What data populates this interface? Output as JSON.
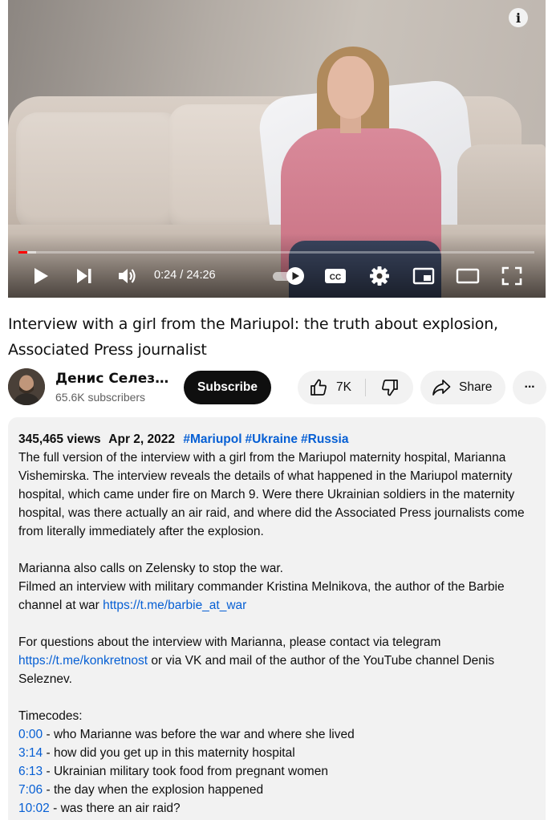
{
  "player": {
    "current_time": "0:24",
    "time_separator": " / ",
    "duration": "24:26",
    "progress_fraction": 0.0164,
    "loaded_fraction": 0.034,
    "info_glyph": "i",
    "icons": [
      "play-icon",
      "next-icon",
      "volume-icon",
      "autoplay-toggle-icon",
      "captions-icon",
      "settings-icon",
      "miniplayer-icon",
      "theater-icon",
      "fullscreen-icon"
    ]
  },
  "video": {
    "title": "Interview with a girl from the Mariupol: the truth about explosion, Associated Press journalist"
  },
  "channel": {
    "name": "Денис Селез…",
    "subscribers": "65.6K subscribers",
    "subscribe_label": "Subscribe"
  },
  "actions": {
    "like_count": "7K",
    "share_label": "Share",
    "more_glyph": "···"
  },
  "description": {
    "views": "345,465 views",
    "date": "Apr 2, 2022",
    "hashtags": [
      "#Mariupol",
      "#Ukraine",
      "#Russia"
    ],
    "p1": "The full version of the interview with a girl from the Mariupol maternity hospital, Marianna Vishemirska. The interview reveals the details of what happened in the Mariupol maternity hospital, which came under fire on March 9. Were there Ukrainian soldiers in the maternity hospital, was there actually an air raid, and where did the Associated Press journalists come from literally immediately after the explosion.",
    "p2_line1": "Marianna also calls on Zelensky to stop the war.",
    "p2_line2": "Filmed an interview with military commander Kristina Melnikova, the author of the Barbie channel at war ",
    "p2_link": "https://t.me/barbie_at_war",
    "p3_pre": "For questions about the interview with Marianna, please contact via telegram ",
    "p3_link": "https://t.me/konkretnost",
    "p3_post": " or via VK and mail of the author of the YouTube channel Denis Seleznev.",
    "timecodes_label": "Timecodes:",
    "timecodes": [
      {
        "time": "0:00",
        "text": " - who Marianne was before the war and where she lived"
      },
      {
        "time": "3:14",
        "text": " - how did you get up in this maternity hospital"
      },
      {
        "time": "6:13",
        "text": " - Ukrainian military took food from pregnant women"
      },
      {
        "time": "7:06",
        "text": " - the day when the explosion happened"
      },
      {
        "time": "10:02",
        "text": " - was there an air raid?"
      }
    ]
  },
  "colors": {
    "accent_red": "#ff0000",
    "link_blue": "#065fd4",
    "chip_bg": "#f2f2f2",
    "text": "#0f0f0f",
    "secondary_text": "#606060"
  }
}
